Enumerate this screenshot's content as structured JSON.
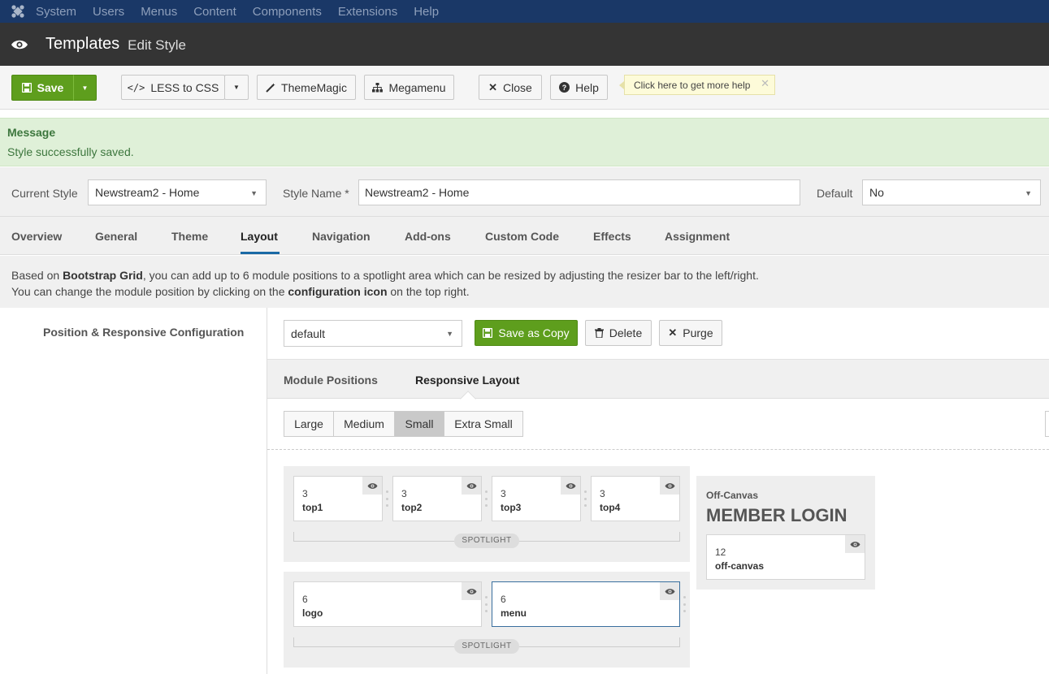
{
  "topnav": {
    "items": [
      "System",
      "Users",
      "Menus",
      "Content",
      "Components",
      "Extensions",
      "Help"
    ]
  },
  "header": {
    "title": "Templates",
    "subtitle": "Edit Style"
  },
  "toolbar": {
    "save": "Save",
    "less_to_css": "LESS to CSS",
    "thememagic": "ThemeMagic",
    "megamenu": "Megamenu",
    "close": "Close",
    "help": "Help",
    "help_tip": "Click here to get more help"
  },
  "message": {
    "heading": "Message",
    "text": "Style successfully saved."
  },
  "style": {
    "current_label": "Current Style",
    "current_value": "Newstream2 - Home",
    "name_label": "Style Name *",
    "name_value": "Newstream2 - Home",
    "default_label": "Default",
    "default_value": "No"
  },
  "tabs": [
    "Overview",
    "General",
    "Theme",
    "Layout",
    "Navigation",
    "Add-ons",
    "Custom Code",
    "Effects",
    "Assignment"
  ],
  "active_tab": "Layout",
  "info": {
    "l1a": "Based on ",
    "l1b": "Bootstrap Grid",
    "l1c": ", you can add up to 6 module positions to a spotlight area which can be resized by adjusting the resizer bar to the left/right.",
    "l2a": "You can change the module position by clicking on the ",
    "l2b": "configuration icon",
    "l2c": " on the top right."
  },
  "config": {
    "label": "Position & Responsive Configuration",
    "layout_select": "default",
    "save_copy": "Save as Copy",
    "delete": "Delete",
    "purge": "Purge"
  },
  "subtabs": [
    "Module Positions",
    "Responsive Layout"
  ],
  "active_subtab": "Responsive Layout",
  "breakpoints": [
    "Large",
    "Medium",
    "Small",
    "Extra Small"
  ],
  "active_breakpoint": "Small",
  "spotlight_label": "SPOTLIGHT",
  "spotlight1": [
    {
      "span": "3",
      "name": "top1"
    },
    {
      "span": "3",
      "name": "top2"
    },
    {
      "span": "3",
      "name": "top3"
    },
    {
      "span": "3",
      "name": "top4"
    }
  ],
  "spotlight2": [
    {
      "span": "6",
      "name": "logo"
    },
    {
      "span": "6",
      "name": "menu"
    }
  ],
  "offcanvas": {
    "label": "Off-Canvas",
    "title": "MEMBER LOGIN",
    "span": "12",
    "name": "off-canvas"
  },
  "colors": {
    "topnav": "#1a3867",
    "titlebar": "#343434",
    "green": "#5e9e1d",
    "message_bg": "#dff0d8",
    "tab_underline": "#1a6aa6"
  }
}
